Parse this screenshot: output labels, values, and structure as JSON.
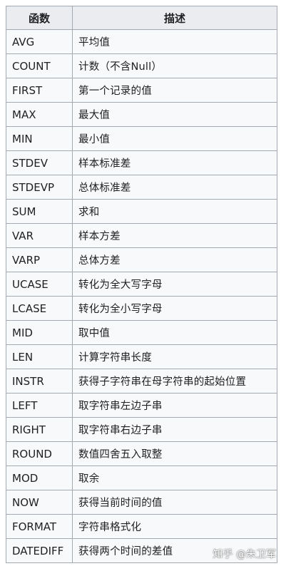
{
  "table": {
    "headers": {
      "function": "函数",
      "description": "描述"
    },
    "rows": [
      {
        "name": "AVG",
        "desc": "平均值"
      },
      {
        "name": "COUNT",
        "desc": "计数（不含Null）"
      },
      {
        "name": "FIRST",
        "desc": "第一个记录的值"
      },
      {
        "name": "MAX",
        "desc": "最大值"
      },
      {
        "name": "MIN",
        "desc": "最小值"
      },
      {
        "name": "STDEV",
        "desc": "样本标准差"
      },
      {
        "name": "STDEVP",
        "desc": "总体标准差"
      },
      {
        "name": "SUM",
        "desc": "求和"
      },
      {
        "name": "VAR",
        "desc": "样本方差"
      },
      {
        "name": "VARP",
        "desc": "总体方差"
      },
      {
        "name": "UCASE",
        "desc": "转化为全大写字母"
      },
      {
        "name": "LCASE",
        "desc": "转化为全小写字母"
      },
      {
        "name": "MID",
        "desc": "取中值"
      },
      {
        "name": "LEN",
        "desc": "计算字符串长度"
      },
      {
        "name": "INSTR",
        "desc": "获得子字符串在母字符串的起始位置"
      },
      {
        "name": "LEFT",
        "desc": "取字符串左边子串"
      },
      {
        "name": "RIGHT",
        "desc": "取字符串右边子串"
      },
      {
        "name": "ROUND",
        "desc": "数值四舍五入取整"
      },
      {
        "name": "MOD",
        "desc": "取余"
      },
      {
        "name": "NOW",
        "desc": "获得当前时间的值"
      },
      {
        "name": "FORMAT",
        "desc": "字符串格式化"
      },
      {
        "name": "DATEDIFF",
        "desc": "获得两个时间的差值"
      }
    ]
  },
  "watermark": "知乎 @朱卫军"
}
